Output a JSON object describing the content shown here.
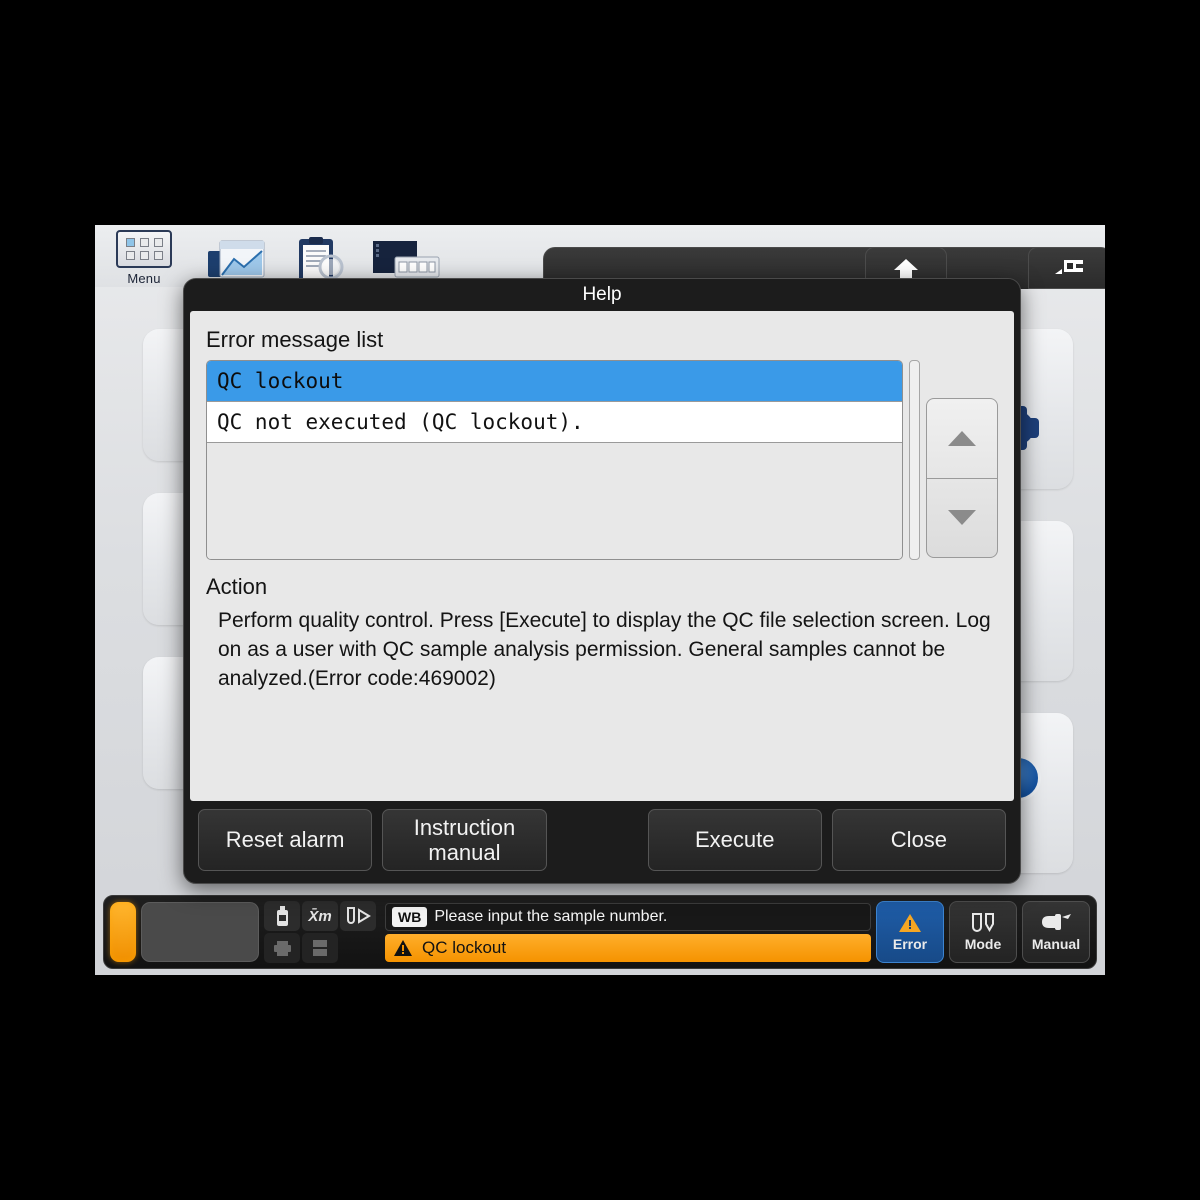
{
  "dialog": {
    "title": "Help",
    "list_section_title": "Error message list",
    "list_items": [
      {
        "text": "QC lockout",
        "selected": true
      },
      {
        "text": "QC not executed (QC lockout).",
        "selected": false
      }
    ],
    "action_section_title": "Action",
    "action_text": "Perform quality control. Press [Execute] to display the QC file selection screen. Log on as a user with QC sample analysis permission. General samples cannot be analyzed.(Error code:469002)",
    "buttons": {
      "reset_alarm": "Reset alarm",
      "instruction_manual": "Instruction manual",
      "execute": "Execute",
      "close": "Close"
    },
    "scroll_up_icon": "triangle-up-icon",
    "scroll_down_icon": "triangle-down-icon"
  },
  "toolbar": {
    "menu_label": "Menu",
    "menu_icon": "grid-menu-icon",
    "icons": [
      "analysis-chart-icon",
      "worklist-clipboard-icon",
      "qc-rack-icon"
    ],
    "header_buttons": [
      "up-arrow-icon",
      "logoff-screen-icon"
    ]
  },
  "statusbar": {
    "indicator_icon": "orange-status-indicator",
    "small_icons": [
      "reagent-bottle-icon",
      "xm-mean-icon",
      "sample-tube-play-icon",
      "printer-icon",
      "host-server-icon"
    ],
    "sample_mode_badge": "WB",
    "message": "Please input the sample number.",
    "error_icon": "warning-triangle-icon",
    "error_message": "QC lockout",
    "buttons": [
      {
        "label": "Error",
        "icon": "warning-triangle-icon",
        "active": true
      },
      {
        "label": "Mode",
        "icon": "tubes-icon",
        "active": false
      },
      {
        "label": "Manual",
        "icon": "hand-tube-icon",
        "active": false
      }
    ]
  },
  "colors": {
    "accent_blue": "#3a9ae8",
    "warning_orange": "#f59300",
    "active_button_blue": "#1f5da8",
    "dialog_dark": "#1c1c1c",
    "panel_gray": "#e8e8e8"
  }
}
